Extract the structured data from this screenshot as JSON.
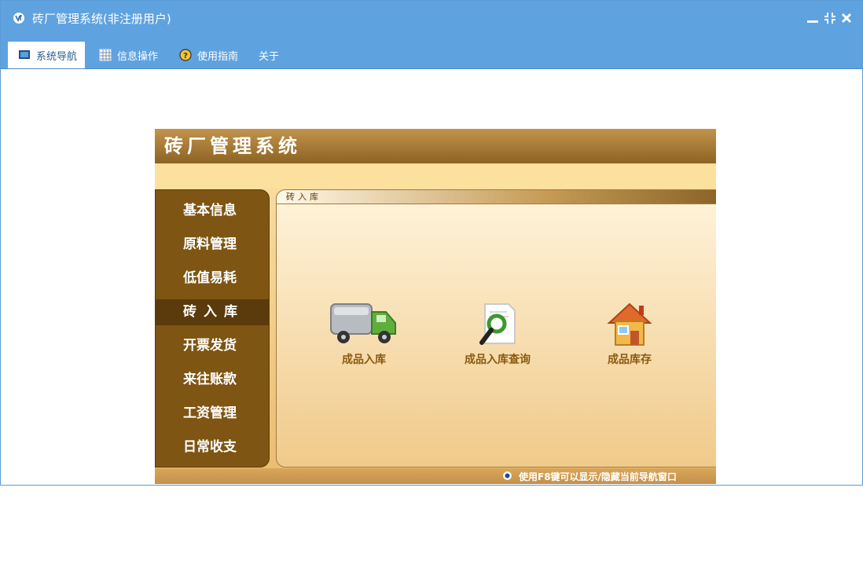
{
  "window": {
    "title": "砖厂管理系统(非注册用户)",
    "controls": [
      "minimize-icon",
      "restore-icon",
      "close-icon"
    ]
  },
  "menubar": {
    "items": [
      {
        "label": "系统导航",
        "icon": "monitor-icon",
        "active": true
      },
      {
        "label": "信息操作",
        "icon": "grid-icon",
        "active": false
      },
      {
        "label": "使用指南",
        "icon": "help-icon",
        "active": false
      },
      {
        "label": "关于",
        "icon": "",
        "active": false
      }
    ]
  },
  "panel": {
    "title": "砖厂管理系统",
    "sidebar": [
      {
        "label": "基本信息"
      },
      {
        "label": "原料管理"
      },
      {
        "label": "低值易耗"
      },
      {
        "label": "砖入库",
        "active": true
      },
      {
        "label": "开票发货"
      },
      {
        "label": "来往账款"
      },
      {
        "label": "工资管理"
      },
      {
        "label": "日常收支"
      }
    ],
    "work_tab": "砖入库",
    "features": [
      {
        "label": "成品入库",
        "icon": "truck-icon"
      },
      {
        "label": "成品入库查询",
        "icon": "magnifier-document-icon"
      },
      {
        "label": "成品库存",
        "icon": "house-icon"
      }
    ],
    "footer_hint": "使用F8键可以显示/隐藏当前导航窗口"
  },
  "colors": {
    "titlebar": "#5ea2e0",
    "panel_header": "#8d6323",
    "sidebar": "#7e5512",
    "feature_label": "#8a5a10"
  }
}
